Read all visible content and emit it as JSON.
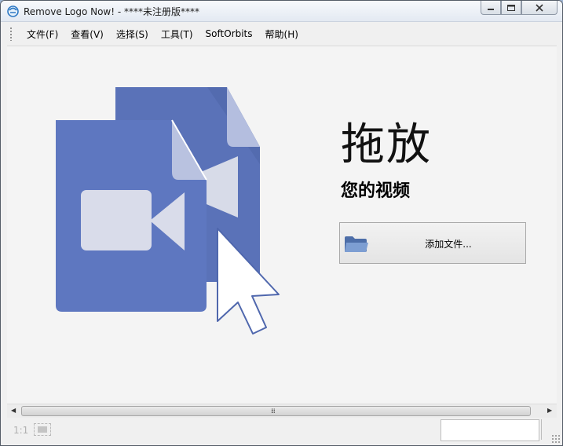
{
  "window": {
    "title": "Remove Logo Now! - ****未注册版****"
  },
  "menu": {
    "items": [
      {
        "label": "文件(F)"
      },
      {
        "label": "查看(V)"
      },
      {
        "label": "选择(S)"
      },
      {
        "label": "工具(T)"
      },
      {
        "label": "SoftOrbits"
      },
      {
        "label": "帮助(H)"
      }
    ]
  },
  "main": {
    "drag_title": "拖放",
    "drag_subtitle": "您的视频",
    "add_file_label": "添加文件..."
  },
  "statusbar": {
    "zoom_label": "1:1",
    "status_text": ""
  },
  "colors": {
    "doc_blue": "#5b74bd",
    "doc_blue_back": "#5a72b8",
    "window_bg": "#f4f4f4"
  },
  "icons": [
    "app-logo-icon",
    "video-document-icon",
    "mouse-pointer-icon",
    "folder-icon",
    "minimize-icon",
    "maximize-icon",
    "close-icon"
  ]
}
